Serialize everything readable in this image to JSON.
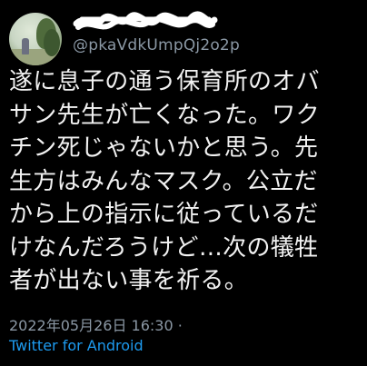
{
  "tweet": {
    "handle": "@pkaVdkUmpQj2o2p",
    "text_lines": [
      "遂に息子の通う保育所のオバ",
      "サン先生が亡くなった。ワク",
      "チン死じゃないかと思う。先",
      "生方はみんなマスク。公立だ",
      "から上の指示に従っているだ",
      "けなんだろうけど…次の犠牲",
      "者が出ない事を祈る。"
    ],
    "timestamp": "2022年05月26日 16:30",
    "separator": "·",
    "source": "Twitter for Android"
  },
  "colors": {
    "background": "#000000",
    "text": "#f2f2f2",
    "muted": "#8b98a5",
    "link": "#1d9bf0"
  },
  "icons": {
    "avatar": "avatar-photo",
    "name": "redacted-scribble"
  }
}
